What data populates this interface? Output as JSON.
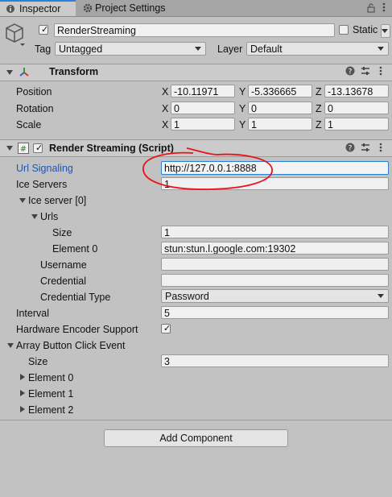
{
  "tabs": [
    {
      "label": "Inspector"
    },
    {
      "label": "Project Settings"
    }
  ],
  "window_icons": [
    "lock-icon",
    "more-options-icon"
  ],
  "object": {
    "active": true,
    "name": "RenderStreaming",
    "static_label": "Static",
    "static_checked": false,
    "tag_label": "Tag",
    "tag_value": "Untagged",
    "layer_label": "Layer",
    "layer_value": "Default"
  },
  "transform": {
    "title": "Transform",
    "rows": [
      {
        "label": "Position",
        "x": "-10.11971",
        "y": "-5.336665",
        "z": "-13.13678"
      },
      {
        "label": "Rotation",
        "x": "0",
        "y": "0",
        "z": "0"
      },
      {
        "label": "Scale",
        "x": "1",
        "y": "1",
        "z": "1"
      }
    ],
    "axes": [
      "X",
      "Y",
      "Z"
    ]
  },
  "script": {
    "title": "Render Streaming (Script)",
    "enabled": true,
    "url_signaling_label": "Url Signaling",
    "url_signaling_value": "http://127.0.0.1:8888",
    "ice_servers_label": "Ice Servers",
    "ice_servers_value": "1",
    "ice_server_0_label": "Ice server [0]",
    "urls_label": "Urls",
    "size_label": "Size",
    "urls_size": "1",
    "element0_label": "Element 0",
    "element0_value": "stun:stun.l.google.com:19302",
    "username_label": "Username",
    "username_value": "",
    "credential_label": "Credential",
    "credential_value": "",
    "credential_type_label": "Credential Type",
    "credential_type_value": "Password",
    "interval_label": "Interval",
    "interval_value": "5",
    "hw_encoder_label": "Hardware Encoder Support",
    "hw_encoder_checked": true,
    "array_button_label": "Array Button Click Event",
    "array_size_label": "Size",
    "array_size_value": "3",
    "elements": [
      "Element 0",
      "Element 1",
      "Element 2"
    ]
  },
  "add_component_label": "Add Component",
  "accent": "#2a7fd6",
  "annotation_color": "#e8141c"
}
